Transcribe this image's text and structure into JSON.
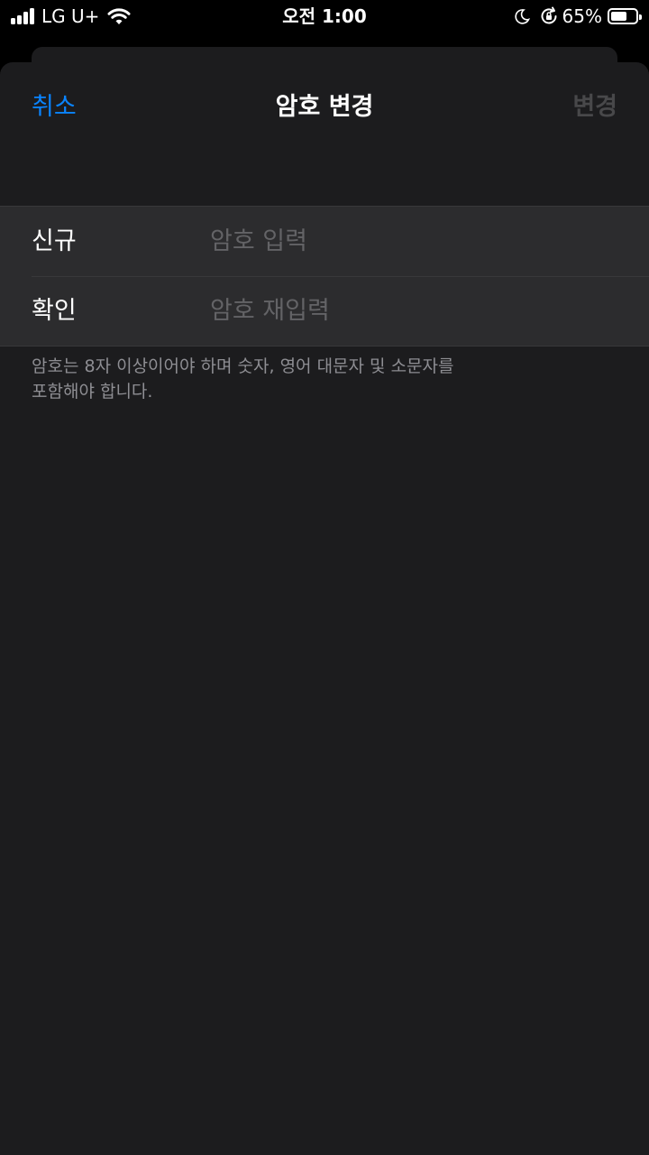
{
  "status_bar": {
    "carrier": "LG U+",
    "time": "오전 1:00",
    "battery_percent": "65%",
    "battery_level": 0.65,
    "icons": [
      "signal-icon",
      "wifi-icon",
      "moon-icon",
      "orientation-lock-icon",
      "battery-icon"
    ]
  },
  "nav": {
    "cancel_label": "취소",
    "title": "암호 변경",
    "change_label": "변경"
  },
  "form": {
    "rows": [
      {
        "label": "신규",
        "placeholder": "암호 입력",
        "value": ""
      },
      {
        "label": "확인",
        "placeholder": "암호 재입력",
        "value": ""
      }
    ]
  },
  "footnote": {
    "line1": "암호는 8자 이상이어야 하며 숫자, 영어 대문자 및 소문자를",
    "line2": "포함해야 합니다."
  },
  "colors": {
    "accent": "#0a84ff",
    "background": "#1c1c1e",
    "group_background": "#2c2c2e",
    "disabled_text": "#48484a",
    "secondary_text": "#8e8e93"
  }
}
